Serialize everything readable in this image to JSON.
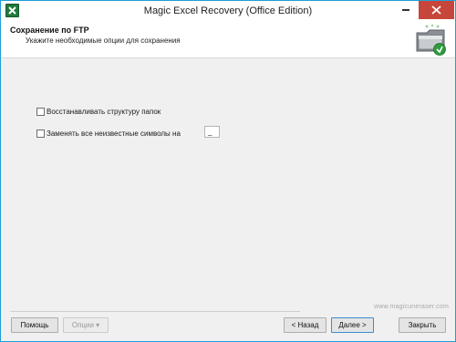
{
  "window": {
    "title": "Magic Excel Recovery (Office Edition)"
  },
  "header": {
    "title": "Сохранение по FTP",
    "subtitle": "Укажите необходимые опции для сохранения"
  },
  "options": {
    "preserve_folders_label": "Восстанавливать структуру папок",
    "preserve_folders_checked": false,
    "replace_unknown_label": "Заменять все неизвестные символы на",
    "replace_unknown_checked": false,
    "replace_char_value": "_"
  },
  "footer": {
    "watermark": "www.magicuneraser.com",
    "help_label": "Помощь",
    "options_label": "Опции ▾",
    "back_label": "< Назад",
    "next_label": "Далее >",
    "close_label": "Закрыть"
  },
  "icons": {
    "app": "excel-app-icon",
    "header": "ftp-folder-icon",
    "minimize": "minimize-icon",
    "close": "close-icon"
  },
  "colors": {
    "window_border": "#1e9fd8",
    "close_button": "#c7463b",
    "app_icon": "#1f7a3c"
  }
}
